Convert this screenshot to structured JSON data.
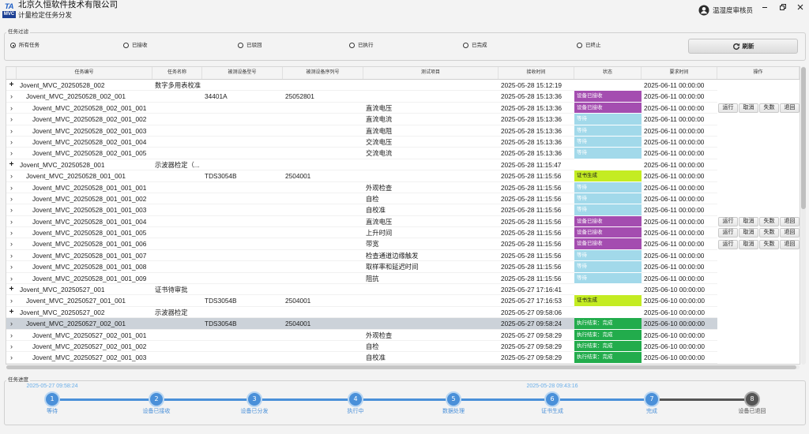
{
  "app": {
    "logo_top": "TA",
    "logo_bottom": "MVC",
    "company": "北京久恒软件技术有限公司",
    "title": "计量检定任务分发"
  },
  "user": {
    "name": "温湿度审核员",
    "icon": "user-icon"
  },
  "window_controls": {
    "icons": [
      "minimize-icon",
      "restore-icon",
      "close-icon"
    ]
  },
  "filter": {
    "legend": "任务过滤",
    "options": [
      "所有任务",
      "已接收",
      "已驳回",
      "已执行",
      "已完成",
      "已终止"
    ],
    "selected": 0,
    "refresh_label": "刷新",
    "refresh_icon": "refresh-icon"
  },
  "table": {
    "columns": [
      "任务编号",
      "任务名称",
      "被测设备型号",
      "被测设备序列号",
      "测试项目",
      "接收时间",
      "状态",
      "要求时间",
      "操作"
    ],
    "ops_labels": [
      "运行",
      "取消",
      "失数",
      "退回"
    ],
    "status_colors": {
      "received": "#a44db0",
      "waiting": "#a2d9ea",
      "cert": "#c4ec22",
      "done": "#22ac4c"
    },
    "selected_row": 21,
    "rows": [
      {
        "exp": "+",
        "lvl": 0,
        "id": "Jovent_MVC_20250528_002",
        "name": "数字多用表校准",
        "recv": "2025-05-28 15:12:19",
        "req": "2025-06-11 00:00:00"
      },
      {
        "exp": "›",
        "lvl": 1,
        "id": "Jovent_MVC_20250528_002_001",
        "model": "34401A",
        "serial": "25052801",
        "recv": "2025-05-28 15:13:36",
        "status": "设备已接收",
        "kind": "received",
        "req": "2025-06-11 00:00:00"
      },
      {
        "exp": "›",
        "lvl": 2,
        "id": "Jovent_MVC_20250528_002_001_001",
        "test": "直流电压",
        "recv": "2025-05-28 15:13:36",
        "status": "设备已接收",
        "kind": "received",
        "req": "2025-06-11 00:00:00",
        "ops": true
      },
      {
        "exp": "›",
        "lvl": 2,
        "id": "Jovent_MVC_20250528_002_001_002",
        "test": "直流电流",
        "recv": "2025-05-28 15:13:36",
        "status": "等待",
        "kind": "waiting",
        "req": "2025-06-11 00:00:00"
      },
      {
        "exp": "›",
        "lvl": 2,
        "id": "Jovent_MVC_20250528_002_001_003",
        "test": "直流电阻",
        "recv": "2025-05-28 15:13:36",
        "status": "等待",
        "kind": "waiting",
        "req": "2025-06-11 00:00:00"
      },
      {
        "exp": "›",
        "lvl": 2,
        "id": "Jovent_MVC_20250528_002_001_004",
        "test": "交流电压",
        "recv": "2025-05-28 15:13:36",
        "status": "等待",
        "kind": "waiting",
        "req": "2025-06-11 00:00:00"
      },
      {
        "exp": "›",
        "lvl": 2,
        "id": "Jovent_MVC_20250528_002_001_005",
        "test": "交流电流",
        "recv": "2025-05-28 15:13:36",
        "status": "等待",
        "kind": "waiting",
        "req": "2025-06-11 00:00:00"
      },
      {
        "exp": "+",
        "lvl": 0,
        "id": "Jovent_MVC_20250528_001",
        "name": "示波器检定（...",
        "recv": "2025-05-28 11:15:47",
        "req": "2025-06-11 00:00:00"
      },
      {
        "exp": "›",
        "lvl": 1,
        "id": "Jovent_MVC_20250528_001_001",
        "model": "TDS3054B",
        "serial": "2504001",
        "recv": "2025-05-28 11:15:56",
        "status": "证书生成",
        "kind": "cert",
        "req": "2025-06-11 00:00:00"
      },
      {
        "exp": "›",
        "lvl": 2,
        "id": "Jovent_MVC_20250528_001_001_001",
        "test": "外观检查",
        "recv": "2025-05-28 11:15:56",
        "status": "等待",
        "kind": "waiting",
        "req": "2025-06-11 00:00:00"
      },
      {
        "exp": "›",
        "lvl": 2,
        "id": "Jovent_MVC_20250528_001_001_002",
        "test": "自检",
        "recv": "2025-05-28 11:15:56",
        "status": "等待",
        "kind": "waiting",
        "req": "2025-06-11 00:00:00"
      },
      {
        "exp": "›",
        "lvl": 2,
        "id": "Jovent_MVC_20250528_001_001_003",
        "test": "自校准",
        "recv": "2025-05-28 11:15:56",
        "status": "等待",
        "kind": "waiting",
        "req": "2025-06-11 00:00:00"
      },
      {
        "exp": "›",
        "lvl": 2,
        "id": "Jovent_MVC_20250528_001_001_004",
        "test": "直流电压",
        "recv": "2025-05-28 11:15:56",
        "status": "设备已接收",
        "kind": "received",
        "req": "2025-06-11 00:00:00",
        "ops": true
      },
      {
        "exp": "›",
        "lvl": 2,
        "id": "Jovent_MVC_20250528_001_001_005",
        "test": "上升时间",
        "recv": "2025-05-28 11:15:56",
        "status": "设备已接收",
        "kind": "received",
        "req": "2025-06-11 00:00:00",
        "ops": true
      },
      {
        "exp": "›",
        "lvl": 2,
        "id": "Jovent_MVC_20250528_001_001_006",
        "test": "带宽",
        "recv": "2025-05-28 11:15:56",
        "status": "设备已接收",
        "kind": "received",
        "req": "2025-06-11 00:00:00",
        "ops": true
      },
      {
        "exp": "›",
        "lvl": 2,
        "id": "Jovent_MVC_20250528_001_001_007",
        "test": "检查通道边缘触发",
        "recv": "2025-05-28 11:15:56",
        "status": "等待",
        "kind": "waiting",
        "req": "2025-06-11 00:00:00"
      },
      {
        "exp": "›",
        "lvl": 2,
        "id": "Jovent_MVC_20250528_001_001_008",
        "test": "取样率和延迟时间",
        "recv": "2025-05-28 11:15:56",
        "status": "等待",
        "kind": "waiting",
        "req": "2025-06-11 00:00:00"
      },
      {
        "exp": "›",
        "lvl": 2,
        "id": "Jovent_MVC_20250528_001_001_009",
        "test": "阻抗",
        "recv": "2025-05-28 11:15:56",
        "status": "等待",
        "kind": "waiting",
        "req": "2025-06-11 00:00:00"
      },
      {
        "exp": "+",
        "lvl": 0,
        "id": "Jovent_MVC_20250527_001",
        "name": "证书待审批",
        "recv": "2025-05-27 17:16:41",
        "req": "2025-06-10 00:00:00"
      },
      {
        "exp": "›",
        "lvl": 1,
        "id": "Jovent_MVC_20250527_001_001",
        "model": "TDS3054B",
        "serial": "2504001",
        "recv": "2025-05-27 17:16:53",
        "status": "证书生成",
        "kind": "cert",
        "req": "2025-06-10 00:00:00"
      },
      {
        "exp": "+",
        "lvl": 0,
        "id": "Jovent_MVC_20250527_002",
        "name": "示波器检定",
        "recv": "2025-05-27 09:58:06",
        "req": "2025-06-10 00:00:00"
      },
      {
        "exp": "›",
        "lvl": 1,
        "id": "Jovent_MVC_20250527_002_001",
        "model": "TDS3054B",
        "serial": "2504001",
        "recv": "2025-05-27 09:58:24",
        "status": "执行结束：完成",
        "kind": "done",
        "req": "2025-06-10 00:00:00"
      },
      {
        "exp": "›",
        "lvl": 2,
        "id": "Jovent_MVC_20250527_002_001_001",
        "test": "外观检查",
        "recv": "2025-05-27 09:58:29",
        "status": "执行结束：完成",
        "kind": "done",
        "req": "2025-06-10 00:00:00"
      },
      {
        "exp": "›",
        "lvl": 2,
        "id": "Jovent_MVC_20250527_002_001_002",
        "test": "自检",
        "recv": "2025-05-27 09:58:29",
        "status": "执行结束：完成",
        "kind": "done",
        "req": "2025-06-10 00:00:00"
      },
      {
        "exp": "›",
        "lvl": 2,
        "id": "Jovent_MVC_20250527_002_001_003",
        "test": "自校准",
        "recv": "2025-05-27 09:58:29",
        "status": "执行结束：完成",
        "kind": "done",
        "req": "2025-06-10 00:00:00"
      }
    ]
  },
  "progress": {
    "legend": "任务进度",
    "colors": {
      "done": "#4a90d9",
      "pending": "#555555"
    },
    "steps": [
      {
        "num": "1",
        "label": "等待",
        "time": "2025-05-27 09:58:24",
        "done": true
      },
      {
        "num": "2",
        "label": "设备已接收",
        "done": true
      },
      {
        "num": "3",
        "label": "设备已分发",
        "done": true
      },
      {
        "num": "4",
        "label": "执行中",
        "done": true
      },
      {
        "num": "5",
        "label": "数据处理",
        "done": true
      },
      {
        "num": "6",
        "label": "证书生成",
        "time": "2025-05-28 09:43:16",
        "done": true
      },
      {
        "num": "7",
        "label": "完成",
        "done": true
      },
      {
        "num": "8",
        "label": "设备已退回",
        "done": false
      }
    ]
  }
}
